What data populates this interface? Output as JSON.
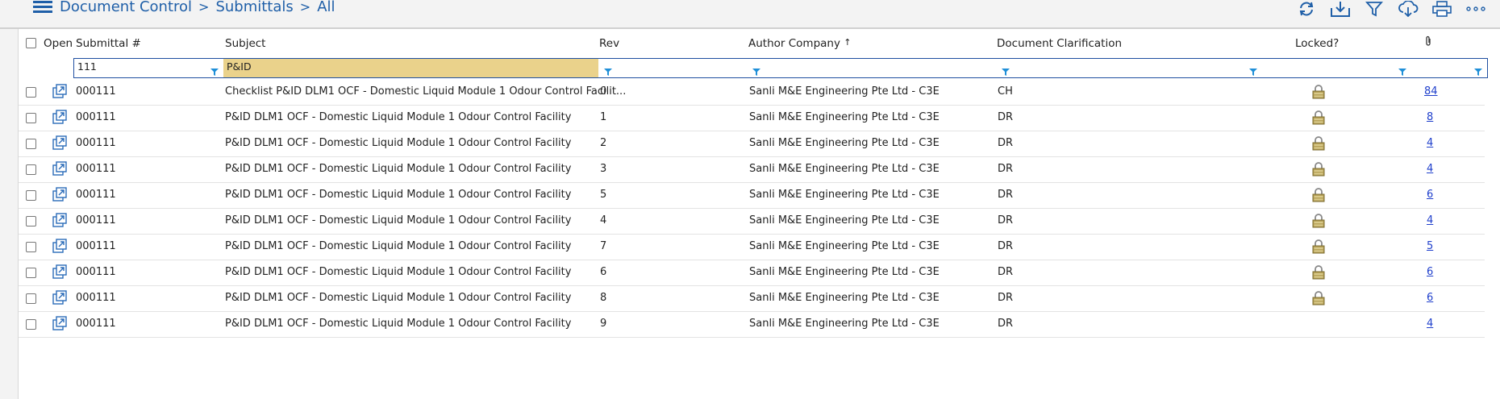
{
  "breadcrumb": {
    "items": [
      "Document Control",
      "Submittals",
      "All"
    ]
  },
  "toolbar": {
    "icons": [
      "refresh-icon",
      "download-icon",
      "filter-icon",
      "cloud-download-icon",
      "print-icon",
      "more-icon"
    ]
  },
  "colors": {
    "accent": "#1f5fa8",
    "filter_highlight": "#ead28b",
    "link": "#1f3fcc"
  },
  "table": {
    "headers": {
      "open": "Open",
      "submittal": "Submittal #",
      "subject": "Subject",
      "rev": "Rev",
      "author": "Author Company",
      "author_sort": "↑",
      "clarification": "Document Clarification",
      "locked": "Locked?",
      "attachments_icon": "paperclip-icon"
    },
    "filters": {
      "submittal": "111",
      "subject": "P&ID"
    },
    "rows": [
      {
        "submittal": "000111",
        "subject": "Checklist P&ID DLM1 OCF - Domestic Liquid Module 1 Odour Control Facilit...",
        "rev": "0",
        "author": "Sanli M&E Engineering Pte Ltd - C3E",
        "clarification": "CH",
        "locked": true,
        "attachments": "84"
      },
      {
        "submittal": "000111",
        "subject": "P&ID DLM1 OCF - Domestic Liquid Module 1 Odour Control Facility",
        "rev": "1",
        "author": "Sanli M&E Engineering Pte Ltd - C3E",
        "clarification": "DR",
        "locked": true,
        "attachments": "8"
      },
      {
        "submittal": "000111",
        "subject": "P&ID DLM1 OCF - Domestic Liquid Module 1 Odour Control Facility",
        "rev": "2",
        "author": "Sanli M&E Engineering Pte Ltd - C3E",
        "clarification": "DR",
        "locked": true,
        "attachments": "4"
      },
      {
        "submittal": "000111",
        "subject": "P&ID DLM1 OCF - Domestic Liquid Module 1 Odour Control Facility",
        "rev": "3",
        "author": "Sanli M&E Engineering Pte Ltd - C3E",
        "clarification": "DR",
        "locked": true,
        "attachments": "4"
      },
      {
        "submittal": "000111",
        "subject": "P&ID DLM1 OCF - Domestic Liquid Module 1 Odour Control Facility",
        "rev": "5",
        "author": "Sanli M&E Engineering Pte Ltd - C3E",
        "clarification": "DR",
        "locked": true,
        "attachments": "6"
      },
      {
        "submittal": "000111",
        "subject": "P&ID DLM1 OCF - Domestic Liquid Module 1 Odour Control Facility",
        "rev": "4",
        "author": "Sanli M&E Engineering Pte Ltd - C3E",
        "clarification": "DR",
        "locked": true,
        "attachments": "4"
      },
      {
        "submittal": "000111",
        "subject": "P&ID DLM1 OCF - Domestic Liquid Module 1 Odour Control Facility",
        "rev": "7",
        "author": "Sanli M&E Engineering Pte Ltd - C3E",
        "clarification": "DR",
        "locked": true,
        "attachments": "5"
      },
      {
        "submittal": "000111",
        "subject": "P&ID DLM1 OCF - Domestic Liquid Module 1 Odour Control Facility",
        "rev": "6",
        "author": "Sanli M&E Engineering Pte Ltd - C3E",
        "clarification": "DR",
        "locked": true,
        "attachments": "6"
      },
      {
        "submittal": "000111",
        "subject": "P&ID DLM1 OCF - Domestic Liquid Module 1 Odour Control Facility",
        "rev": "8",
        "author": "Sanli M&E Engineering Pte Ltd - C3E",
        "clarification": "DR",
        "locked": true,
        "attachments": "6"
      },
      {
        "submittal": "000111",
        "subject": "P&ID DLM1 OCF - Domestic Liquid Module 1 Odour Control Facility",
        "rev": "9",
        "author": "Sanli M&E Engineering Pte Ltd - C3E",
        "clarification": "DR",
        "locked": false,
        "attachments": "4"
      }
    ]
  }
}
